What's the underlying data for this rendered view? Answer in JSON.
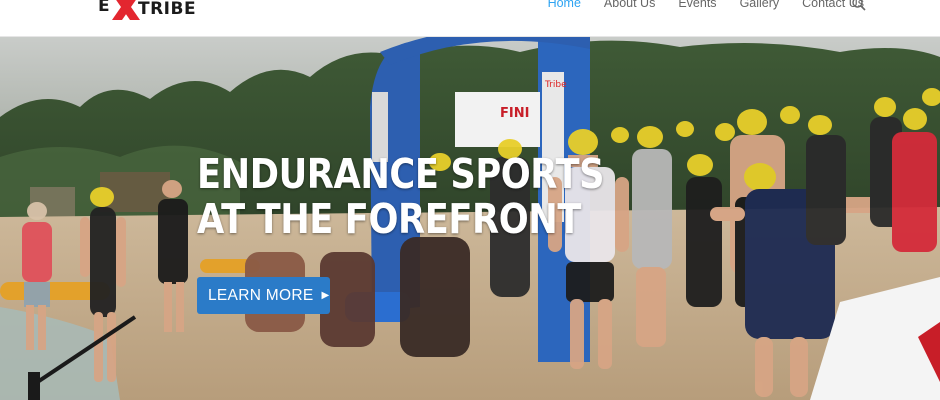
{
  "brand": {
    "logo_left": "E",
    "logo_right": "TRIBE",
    "accent": "#e3262f"
  },
  "nav": {
    "items": [
      {
        "label": "Home",
        "active": true
      },
      {
        "label": "About Us",
        "active": false
      },
      {
        "label": "Events",
        "active": false
      },
      {
        "label": "Gallery",
        "active": false
      },
      {
        "label": "Contact Us",
        "active": false
      }
    ],
    "active_color": "#2ea3f2",
    "search_icon": "search-icon"
  },
  "hero": {
    "title_line1": "ENDURANCE SPORTS",
    "title_line2": "AT THE FOREFRONT",
    "button_label": "LEARN MORE",
    "button_icon": "chevron-right-icon",
    "button_color": "#2b7bc8",
    "arch_sign": "FINI",
    "arch_brand": "Tribe"
  }
}
